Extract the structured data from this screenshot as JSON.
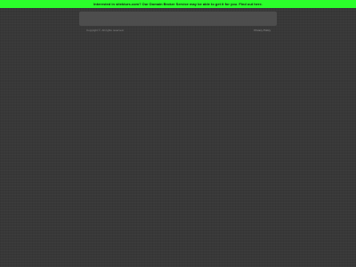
{
  "banner": {
    "text": "Interested in siteblurs.com? Our Domain Broker Service may be able to get it for you.  Find out here.",
    "background_color": "#2bff2b"
  },
  "page": {
    "background_color": "#383838",
    "panel_color": "#4d4d4d"
  },
  "footer": {
    "copyright": "Copyright ©. All rights reserved.",
    "privacy_label": "Privacy Policy"
  }
}
